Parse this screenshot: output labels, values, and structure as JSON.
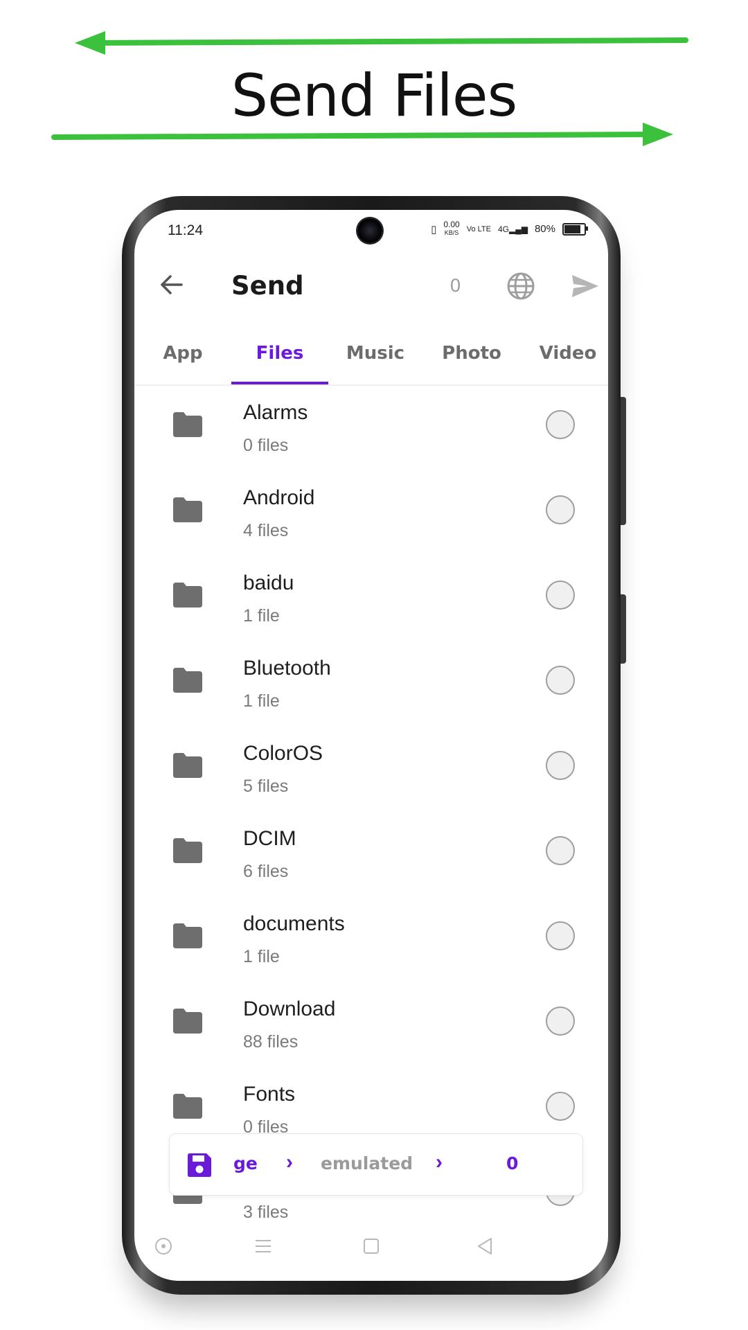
{
  "banner": {
    "title": "Send Files",
    "arrow_color": "#3cc13c"
  },
  "status_bar": {
    "time": "11:24",
    "net_speed": "0.00",
    "net_unit": "KB/S",
    "volte": "Vo LTE",
    "network": "4G",
    "battery": "80%"
  },
  "app_bar": {
    "title": "Send",
    "selected_count": "0",
    "back_icon": "arrow-left-icon",
    "globe_icon": "globe-icon",
    "send_icon": "send-icon"
  },
  "tabs": [
    {
      "label": "App",
      "active": false
    },
    {
      "label": "Files",
      "active": true
    },
    {
      "label": "Music",
      "active": false
    },
    {
      "label": "Photo",
      "active": false
    },
    {
      "label": "Video",
      "active": false
    }
  ],
  "accent_color": "#6a1ad8",
  "folders": [
    {
      "name": "Alarms",
      "count": "0 files"
    },
    {
      "name": "Android",
      "count": "4 files"
    },
    {
      "name": "baidu",
      "count": "1 file"
    },
    {
      "name": "Bluetooth",
      "count": "1 file"
    },
    {
      "name": "ColorOS",
      "count": "5 files"
    },
    {
      "name": "DCIM",
      "count": "6 files"
    },
    {
      "name": "documents",
      "count": "1 file"
    },
    {
      "name": "Download",
      "count": "88 files"
    },
    {
      "name": "Fonts",
      "count": "0 files"
    },
    {
      "name": "",
      "count": "3 files"
    }
  ],
  "path_bar": {
    "segments": [
      "ge",
      "emulated",
      "0"
    ],
    "icon": "save-disk-icon"
  },
  "nav_bar": [
    "assistant-icon",
    "menu-icon",
    "home-square-icon",
    "back-triangle-icon"
  ]
}
